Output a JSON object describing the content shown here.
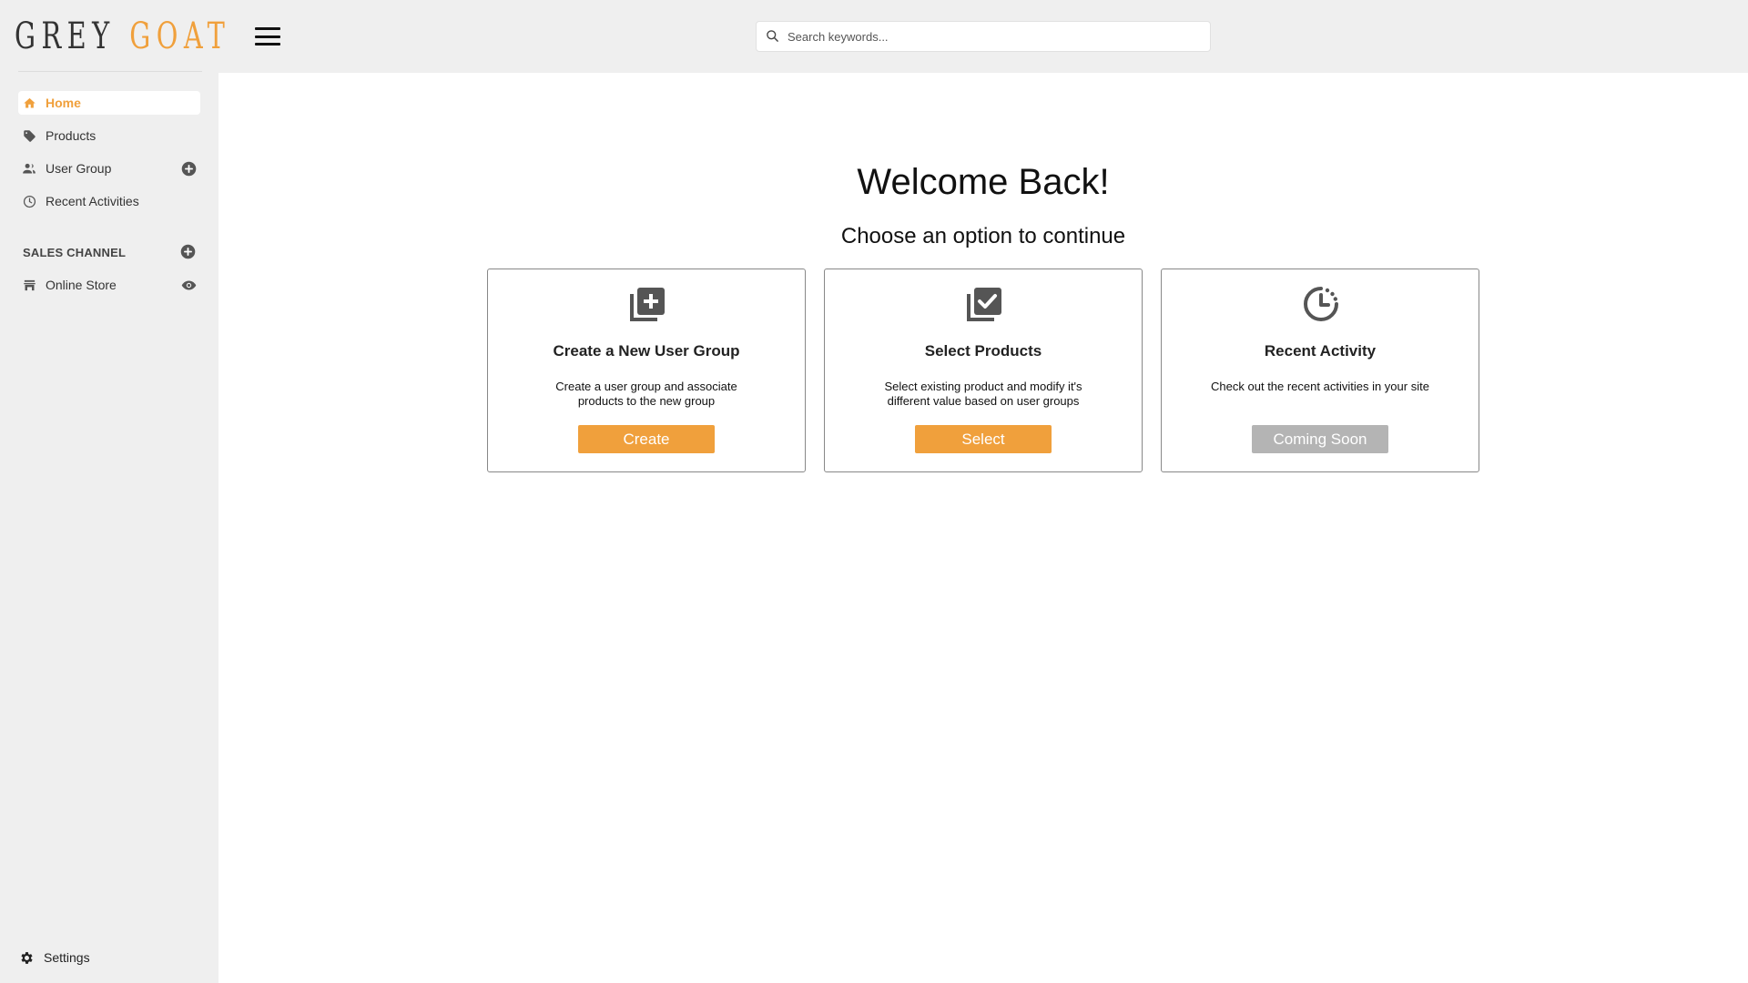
{
  "brand": {
    "part1": "GREY",
    "part2": "GOAT",
    "accent_color": "#f0a03c"
  },
  "sidebar": {
    "items": [
      {
        "label": "Home",
        "icon": "home-icon",
        "active": true
      },
      {
        "label": "Products",
        "icon": "tag-icon"
      },
      {
        "label": "User Group",
        "icon": "user-group-icon",
        "action_icon": "add-circle-icon"
      },
      {
        "label": "Recent Activities",
        "icon": "clock-icon"
      }
    ],
    "section": {
      "title": "SALES CHANNEL",
      "action_icon": "add-circle-icon",
      "items": [
        {
          "label": "Online Store",
          "icon": "store-icon",
          "action_icon": "eye-icon"
        }
      ]
    },
    "settings_label": "Settings"
  },
  "topbar": {
    "menu_icon": "hamburger-icon",
    "search": {
      "placeholder": "Search keywords...",
      "value": ""
    }
  },
  "main": {
    "heading": "Welcome Back!",
    "subheading": "Choose an option to continue",
    "cards": [
      {
        "title": "Create a New User Group",
        "description": "Create a user group and associate products to the new group",
        "button": "Create",
        "icon": "library-add-icon",
        "enabled": true
      },
      {
        "title": "Select Products",
        "description": "Select existing product and modify it's different value based on user groups",
        "button": "Select",
        "icon": "library-check-icon",
        "enabled": true
      },
      {
        "title": "Recent Activity",
        "description": "Check out the recent activities in your site",
        "button": "Coming Soon",
        "icon": "clock-dashed-icon",
        "enabled": false
      }
    ]
  }
}
